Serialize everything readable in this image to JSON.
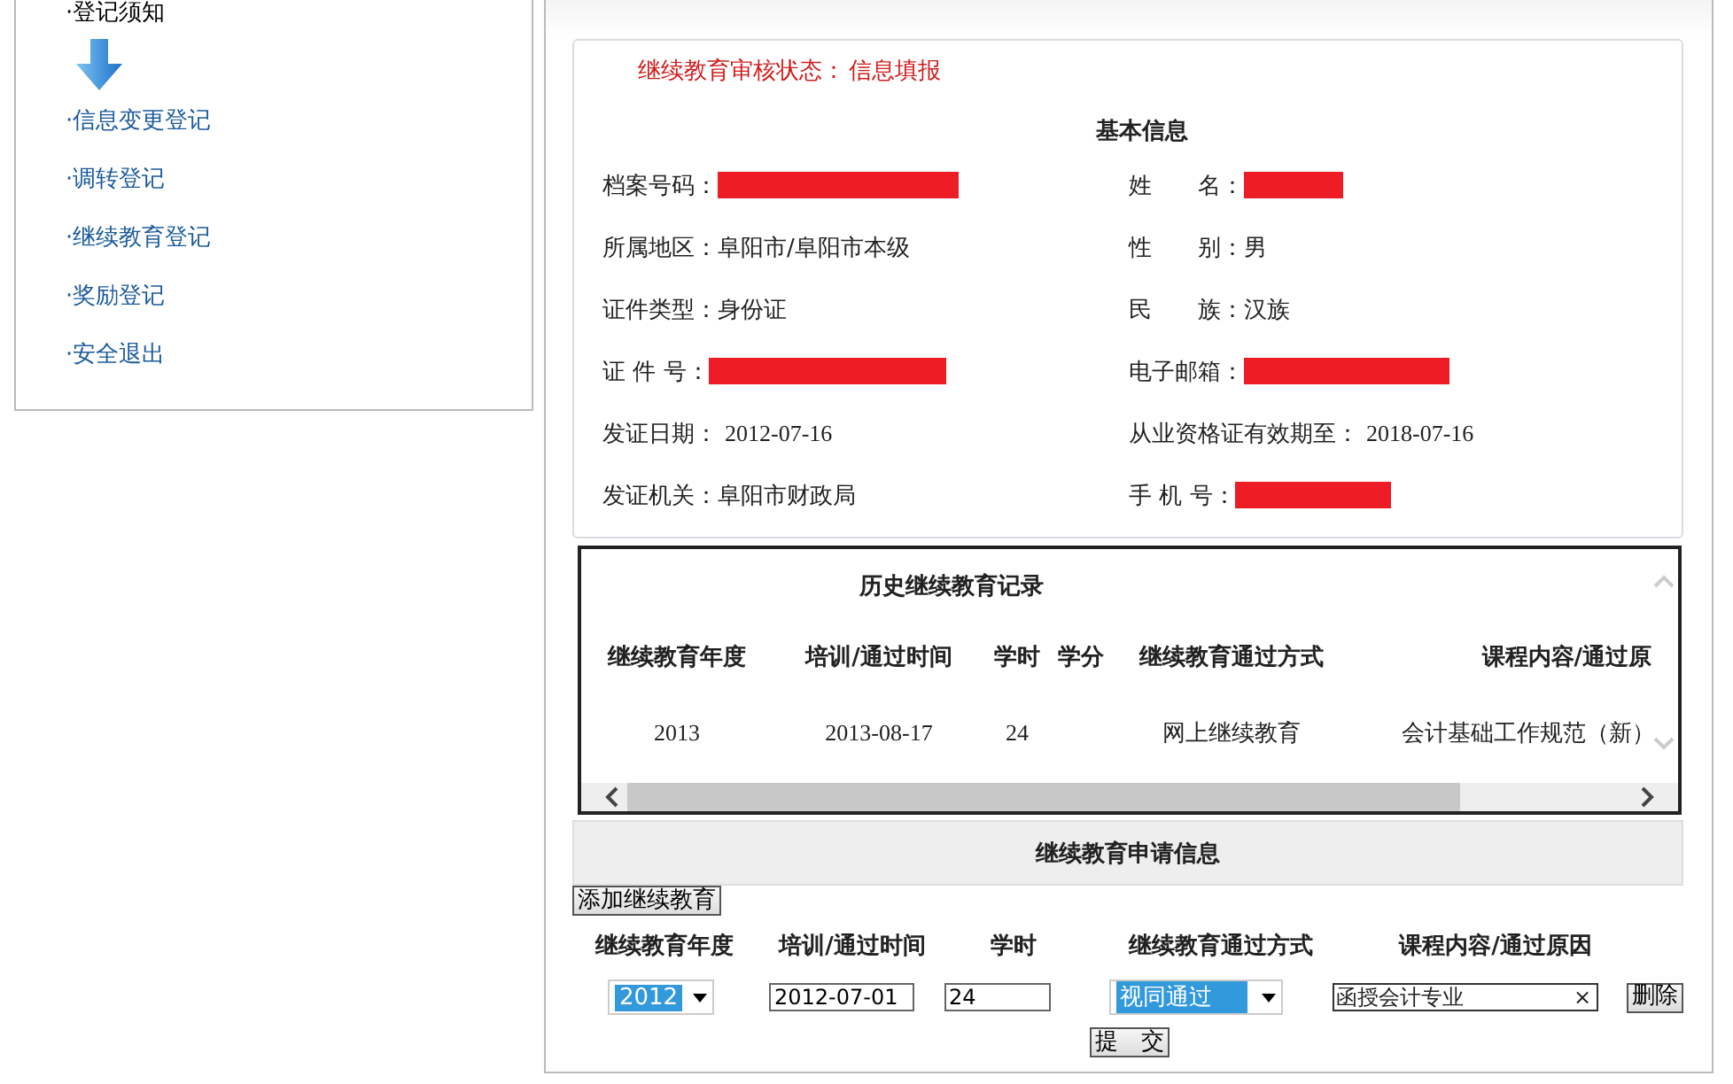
{
  "sidebar": {
    "items": [
      {
        "label": "·登记须知",
        "kind": "heading"
      },
      {
        "label": "·信息变更登记",
        "kind": "link"
      },
      {
        "label": "·调转登记",
        "kind": "link"
      },
      {
        "label": "·继续教育登记",
        "kind": "link"
      },
      {
        "label": "·奖励登记",
        "kind": "link"
      },
      {
        "label": "·安全退出",
        "kind": "link"
      }
    ]
  },
  "status": {
    "label": "继续教育审核状态：",
    "value": "信息填报"
  },
  "basic_info": {
    "title": "基本信息",
    "fields": [
      {
        "label": "档案号码：",
        "redacted": true
      },
      {
        "label": "姓　　名：",
        "redacted": true
      },
      {
        "label": "所属地区：",
        "value": "阜阳市/阜阳市本级",
        "redacted": false
      },
      {
        "label": "性　　别：",
        "value": "男",
        "redacted": false
      },
      {
        "label": "证件类型：",
        "value": "身份证",
        "redacted": false
      },
      {
        "label": "民　　族：",
        "value": "汉族",
        "redacted": false
      },
      {
        "label": "证 件 号：",
        "redacted": true
      },
      {
        "label": "电子邮箱：",
        "redacted": true
      },
      {
        "label": "发证日期：",
        "value": "2012-07-16",
        "redacted": false
      },
      {
        "label": "从业资格证有效期至：",
        "value": "2018-07-16",
        "redacted": false
      },
      {
        "label": "发证机关：",
        "value": "阜阳市财政局",
        "redacted": false
      },
      {
        "label": "手 机 号：",
        "redacted": true
      }
    ]
  },
  "history": {
    "title": "历史继续教育记录",
    "columns": [
      "继续教育年度",
      "培训/通过时间",
      "学时",
      "学分",
      "继续教育通过方式",
      "课程内容/通过原"
    ],
    "rows": [
      {
        "year": "2013",
        "date": "2013-08-17",
        "hours": "24",
        "method": "网上继续教育",
        "course": "会计基础工作规范（新）"
      }
    ]
  },
  "application": {
    "title": "继续教育申请信息",
    "add_button": "添加继续教育",
    "columns": [
      "继续教育年度",
      "培训/通过时间",
      "学时",
      "继续教育通过方式",
      "课程内容/通过原因"
    ],
    "entry": {
      "year": "2012",
      "date": "2012-07-01",
      "hours": "24",
      "method": "视同通过",
      "course": "函授会计专业",
      "clear": "×",
      "delete_button": "删除"
    },
    "submit_button": "提　交"
  }
}
